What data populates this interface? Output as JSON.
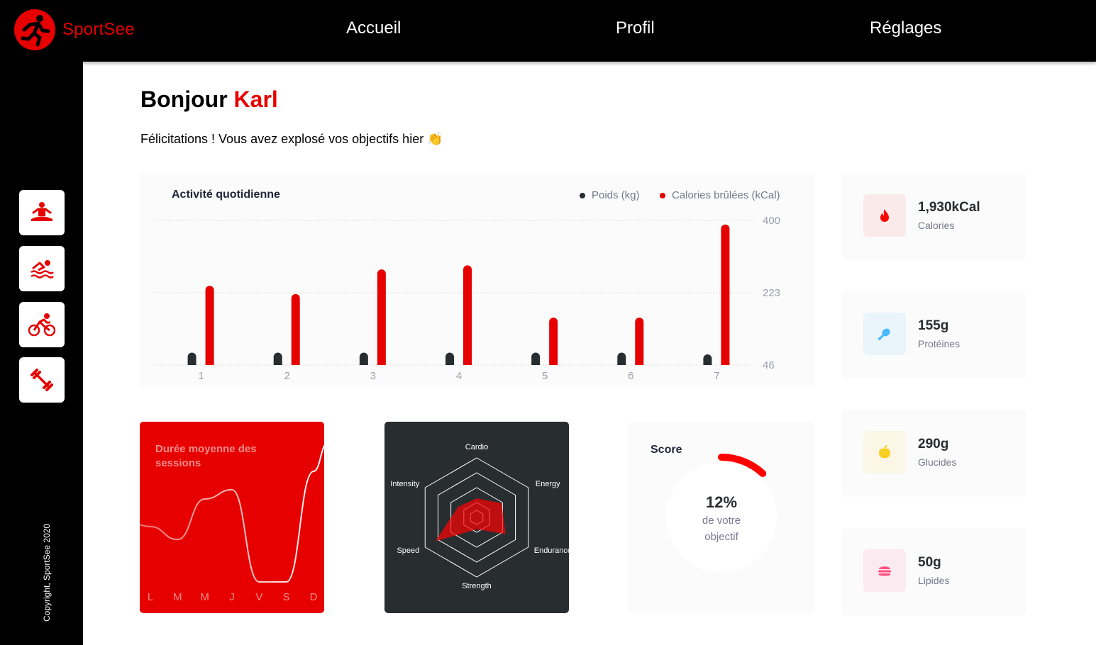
{
  "app": {
    "name": "SportSee"
  },
  "nav": {
    "items": [
      {
        "label": "Accueil"
      },
      {
        "label": "Profil"
      },
      {
        "label": "Réglages"
      }
    ]
  },
  "sidebar": {
    "icons": [
      "meditation-icon",
      "swimming-icon",
      "cycling-icon",
      "dumbbell-icon"
    ],
    "copyright": "Copyright, SportSee 2020"
  },
  "greeting": {
    "prefix": "Bonjour ",
    "name": "Karl",
    "message": "Félicitations ! Vous avez explosé vos objectifs hier 👏"
  },
  "activity": {
    "title": "Activité quotidienne",
    "legend": {
      "weight": "Poids (kg)",
      "calories": "Calories brûlées (kCal)"
    }
  },
  "key_data": [
    {
      "value": "1,930kCal",
      "label": "Calories",
      "icon": "fire-icon",
      "icon_bg": "#FBEAEA",
      "icon_color": "#FF0000"
    },
    {
      "value": "155g",
      "label": "Protéines",
      "icon": "chicken-icon",
      "icon_bg": "#E9F4FB",
      "icon_color": "#4AB8FF"
    },
    {
      "value": "290g",
      "label": "Glucides",
      "icon": "apple-icon",
      "icon_bg": "#FBF6E5",
      "icon_color": "#F9CE23"
    },
    {
      "value": "50g",
      "label": "Lipides",
      "icon": "burger-icon",
      "icon_bg": "#FBEAEF",
      "icon_color": "#FD5181"
    }
  ],
  "sessions": {
    "title": "Durée moyenne des sessions"
  },
  "score": {
    "title": "Score",
    "value": "12%",
    "text": "de votre objectif"
  },
  "colors": {
    "accent": "#E60000",
    "dark": "#282D30",
    "weight_bar": "#282D30",
    "calories_bar": "#E60000"
  },
  "chart_data": [
    {
      "type": "bar",
      "categories": [
        "1",
        "2",
        "3",
        "4",
        "5",
        "6",
        "7"
      ],
      "series": [
        {
          "name": "Poids (kg)",
          "values": [
            69,
            69,
            69,
            69,
            69,
            69,
            68
          ]
        },
        {
          "name": "Calories brûlées (kCal)",
          "values": [
            240,
            220,
            280,
            290,
            162,
            162,
            390
          ]
        }
      ],
      "yticks": [
        46,
        223,
        400
      ],
      "ylim": [
        46,
        400
      ],
      "grid": true,
      "legend": "top-right"
    },
    {
      "type": "line",
      "categories": [
        "L",
        "M",
        "M",
        "J",
        "V",
        "S",
        "D"
      ],
      "values": [
        30,
        23,
        45,
        50,
        0,
        0,
        60
      ],
      "title": "Durée moyenne des sessions"
    },
    {
      "type": "radar",
      "categories": [
        "Cardio",
        "Energy",
        "Endurance",
        "Strength",
        "Speed",
        "Intensity"
      ],
      "values": [
        80,
        120,
        140,
        50,
        200,
        90
      ],
      "max": 250
    },
    {
      "type": "radial",
      "value": 0.12,
      "label": "12%"
    }
  ]
}
